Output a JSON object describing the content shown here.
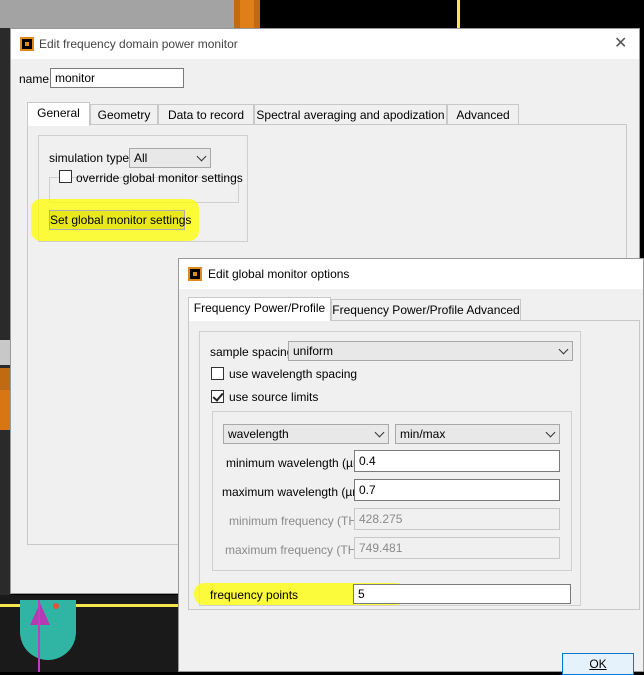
{
  "colors": {
    "highlight": "#ffff00",
    "accent_orange": "#e08a1c",
    "scene_teal": "#30b5a5",
    "scene_magenta": "#c03cc0"
  },
  "outer_dialog": {
    "title": "Edit frequency domain power monitor",
    "close_icon": "close-icon",
    "name_label": "name",
    "name_value": "monitor",
    "tabs": [
      "General",
      "Geometry",
      "Data to record",
      "Spectral averaging and apodization",
      "Advanced"
    ],
    "active_tab": "General",
    "simulation_type_label": "simulation type",
    "simulation_type_value": "All",
    "override_label": "override global monitor settings",
    "override_checked": false,
    "set_global_button": "Set global monitor settings"
  },
  "inner_dialog": {
    "title": "Edit global monitor options",
    "tabs": [
      "Frequency Power/Profile",
      "Frequency Power/Profile Advanced"
    ],
    "active_tab": "Frequency Power/Profile",
    "sample_spacing_label": "sample spacing",
    "sample_spacing_value": "uniform",
    "use_wavelength_spacing_label": "use wavelength spacing",
    "use_wavelength_spacing_checked": false,
    "use_source_limits_label": "use source limits",
    "use_source_limits_checked": true,
    "range_type_value": "wavelength",
    "range_mode_value": "min/max",
    "min_wavelength_label": "minimum wavelength (µm)",
    "min_wavelength_value": "0.4",
    "max_wavelength_label": "maximum wavelength (µm)",
    "max_wavelength_value": "0.7",
    "min_frequency_label": "minimum frequency (THz)",
    "min_frequency_value": "428.275",
    "max_frequency_label": "maximum frequency (THz)",
    "max_frequency_value": "749.481",
    "frequency_points_label": "frequency points",
    "frequency_points_value": "5",
    "ok_button": "OK"
  }
}
